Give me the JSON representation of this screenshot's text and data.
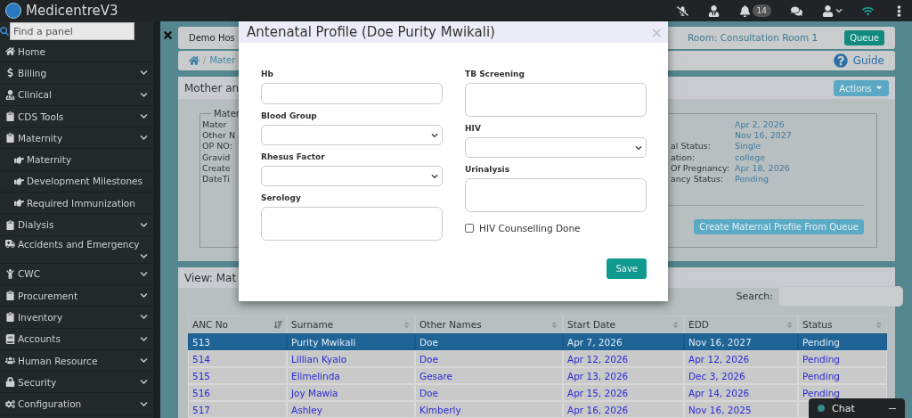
{
  "app": {
    "title": "MedicentreV3",
    "notifications": "14"
  },
  "sidebar": {
    "search_placeholder": "Find a panel",
    "items": [
      {
        "label": "Home",
        "kind": "link"
      },
      {
        "label": "Billing",
        "kind": "menu"
      },
      {
        "label": "Clinical",
        "kind": "menu"
      },
      {
        "label": "CDS Tools",
        "kind": "menu"
      },
      {
        "label": "Maternity",
        "kind": "menu",
        "children": [
          {
            "label": "Maternity"
          },
          {
            "label": "Development Milestones"
          },
          {
            "label": "Required Immunization"
          }
        ]
      },
      {
        "label": "Dialysis",
        "kind": "menu"
      },
      {
        "label": "Accidents and Emergency",
        "kind": "menu"
      },
      {
        "label": "CWC",
        "kind": "menu"
      },
      {
        "label": "Procurement",
        "kind": "menu"
      },
      {
        "label": "Inventory",
        "kind": "menu"
      },
      {
        "label": "Accounts",
        "kind": "menu"
      },
      {
        "label": "Human Resource",
        "kind": "menu"
      },
      {
        "label": "Security",
        "kind": "menu"
      },
      {
        "label": "Configuration",
        "kind": "menu"
      }
    ]
  },
  "header": {
    "hospital": "Demo Hos",
    "room": "Room: Consultation Room 1",
    "queue_button": "Queue"
  },
  "breadcrumb": {
    "separator": "/",
    "item": "Mater",
    "guide": "Guide"
  },
  "profile_panel": {
    "title": "Mother an",
    "actions_button": "Actions",
    "legend": "Mater",
    "left_labels": [
      "Mater",
      "Other N",
      "OP NO:",
      "Gravid",
      "Create",
      "DateTi"
    ],
    "right_rows": [
      {
        "value": "Apr 2, 2026"
      },
      {
        "value": "Nov 16, 2027"
      },
      {
        "label": "al Status:",
        "value": "Single"
      },
      {
        "label": "ation:",
        "value": "college"
      },
      {
        "label": "Of Pregnancy:",
        "value": "Apr 18, 2026"
      },
      {
        "label": "ancy Status:",
        "value": "Pending"
      }
    ],
    "create_button": "Create Maternal Profile From Queue"
  },
  "table_panel": {
    "title": "View: Mat",
    "search_label": "Search:",
    "columns": [
      {
        "label": "ANC No",
        "sorted": true
      },
      {
        "label": "Surname",
        "sorted": false
      },
      {
        "label": "Other Names",
        "sorted": false
      },
      {
        "label": "Start Date",
        "sorted": false
      },
      {
        "label": "EDD",
        "sorted": false
      },
      {
        "label": "Status",
        "sorted": false
      }
    ],
    "rows": [
      {
        "selected": true,
        "cells": [
          "513",
          "Purity Mwikali",
          "Doe",
          "Apr 7, 2026",
          "Nov 16, 2027",
          "Pending"
        ]
      },
      {
        "selected": false,
        "cells": [
          "514",
          "Lillian Kyalo",
          "Doe",
          "Apr 12, 2026",
          "Apr 12, 2026",
          "Pending"
        ]
      },
      {
        "selected": false,
        "cells": [
          "515",
          "Elimelinda",
          "Gesare",
          "Apr 13, 2026",
          "Dec 3, 2026",
          "Pending"
        ]
      },
      {
        "selected": false,
        "cells": [
          "516",
          "Joy Mawia",
          "Doe",
          "Apr 15, 2026",
          "Apr 14, 2026",
          "Pending"
        ]
      },
      {
        "selected": false,
        "cells": [
          "517",
          "Ashley",
          "Kimberly",
          "Apr 16, 2026",
          "Nov 16, 2025"
        ]
      }
    ]
  },
  "chat": {
    "label": "Chat"
  },
  "modal": {
    "title": "Antenatal Profile (Doe Purity Mwikali)",
    "close": "×",
    "save_button": "Save",
    "left_fields": [
      {
        "label": "Hb",
        "kind": "input"
      },
      {
        "label": "Blood Group",
        "kind": "select"
      },
      {
        "label": "Rhesus Factor",
        "kind": "select"
      },
      {
        "label": "Serology",
        "kind": "textarea"
      }
    ],
    "right_fields": [
      {
        "label": "TB Screening",
        "kind": "textarea"
      },
      {
        "label": "HIV",
        "kind": "select"
      },
      {
        "label": "Urinalysis",
        "kind": "textarea"
      },
      {
        "label": "HIV Counselling Done",
        "kind": "checkbox",
        "checked": false
      }
    ]
  }
}
